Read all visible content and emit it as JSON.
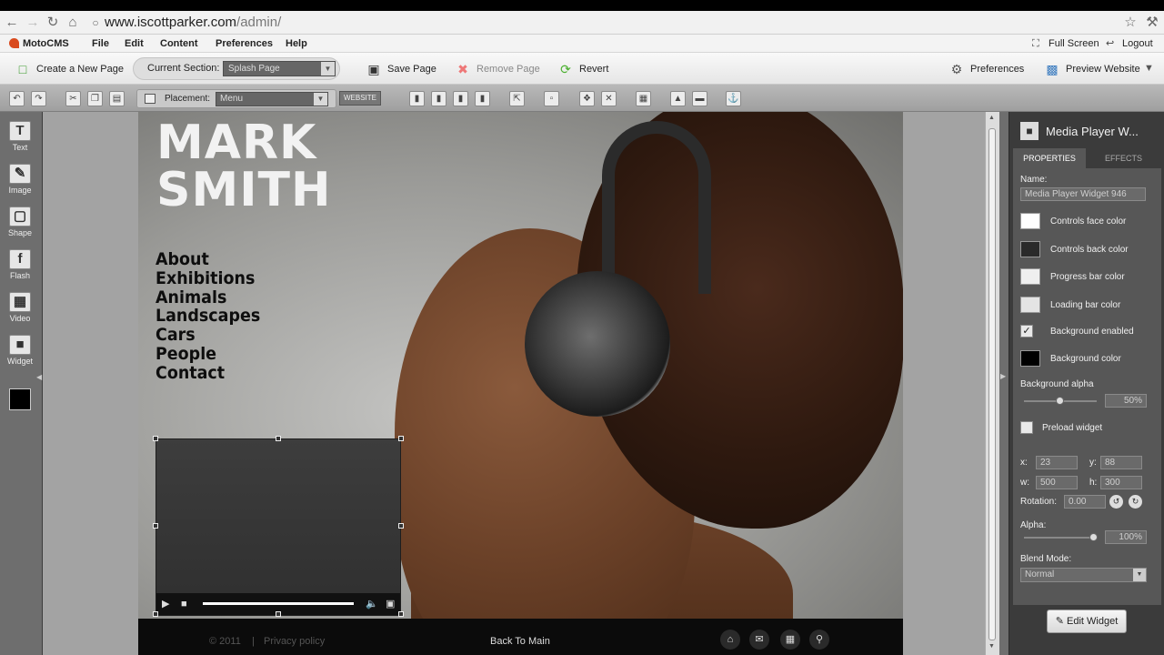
{
  "browser": {
    "url_host": "www.iscottparker.com",
    "url_path": "/admin/"
  },
  "menubar": {
    "logo": "MotoCMS",
    "items": [
      "File",
      "Edit",
      "Content",
      "Preferences",
      "Help"
    ],
    "full_screen": "Full Screen",
    "logout": "Logout"
  },
  "toolbar": {
    "create_page": "Create a New Page",
    "current_section_label": "Current Section:",
    "current_section_value": "Splash Page",
    "save_page": "Save Page",
    "remove_page": "Remove Page",
    "revert": "Revert",
    "preferences": "Preferences",
    "preview": "Preview Website"
  },
  "toolbar2": {
    "placement_label": "Placement:",
    "placement_value": "Menu",
    "website_label": "WEBSITE"
  },
  "left_tools": [
    "Text",
    "Image",
    "Shape",
    "Flash",
    "Video",
    "Widget"
  ],
  "site": {
    "brand_line1": "MARK",
    "brand_line2": "SMITH",
    "nav": [
      "About",
      "Exhibitions",
      "Animals",
      "Landscapes",
      "Cars",
      "People",
      "Contact"
    ],
    "player_progress": 1.0,
    "footer_copyright": "© 2011",
    "footer_sep": "|",
    "footer_privacy": "Privacy policy",
    "footer_back": "Back To Main"
  },
  "panel": {
    "title": "Media Player W...",
    "tabs": [
      "PROPERTIES",
      "EFFECTS"
    ],
    "name_label": "Name:",
    "name_value": "Media Player Widget 946",
    "controls_face": "Controls face color",
    "controls_back": "Controls back color",
    "progress_bar": "Progress bar color",
    "loading_bar": "Loading bar color",
    "bg_enabled": "Background enabled",
    "bg_color": "Background color",
    "bg_alpha_label": "Background alpha",
    "bg_alpha_value": "50%",
    "preload": "Preload widget",
    "x_label": "x:",
    "x_value": "23",
    "y_label": "y:",
    "y_value": "88",
    "w_label": "w:",
    "w_value": "500",
    "h_label": "h:",
    "h_value": "300",
    "rotation_label": "Rotation:",
    "rotation_value": "0.00",
    "alpha_label": "Alpha:",
    "alpha_value": "100%",
    "blend_label": "Blend Mode:",
    "blend_value": "Normal",
    "edit_widget": "Edit Widget",
    "colors": {
      "controls_face": "#ffffff",
      "controls_back": "#2a2a2a",
      "progress_bar": "#efefef",
      "loading_bar": "#e4e4e4",
      "background": "#000000"
    }
  }
}
